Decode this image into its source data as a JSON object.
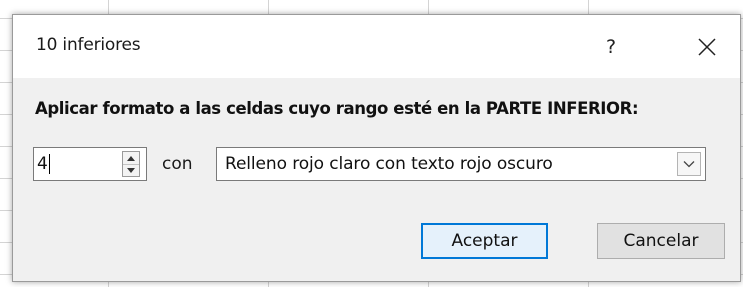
{
  "dialog": {
    "title": "10 inferiores",
    "help_label": "?",
    "instruction": "Aplicar formato a las celdas cuyo rango esté en la PARTE INFERIOR:",
    "count_value": "4",
    "with_label": "con",
    "format_selected": "Relleno rojo claro con texto rojo oscuro",
    "ok_label": "Aceptar",
    "cancel_label": "Cancelar"
  },
  "icons": {
    "close": "close-icon",
    "spin_up": "chevron-up-icon",
    "spin_down": "chevron-down-icon",
    "dropdown": "chevron-down-icon"
  },
  "colors": {
    "dialog_bg": "#f0f0f0",
    "titlebar_bg": "#ffffff",
    "default_button_border": "#0078d7",
    "default_button_bg": "#e5f1fb",
    "button_bg": "#e1e1e1"
  }
}
